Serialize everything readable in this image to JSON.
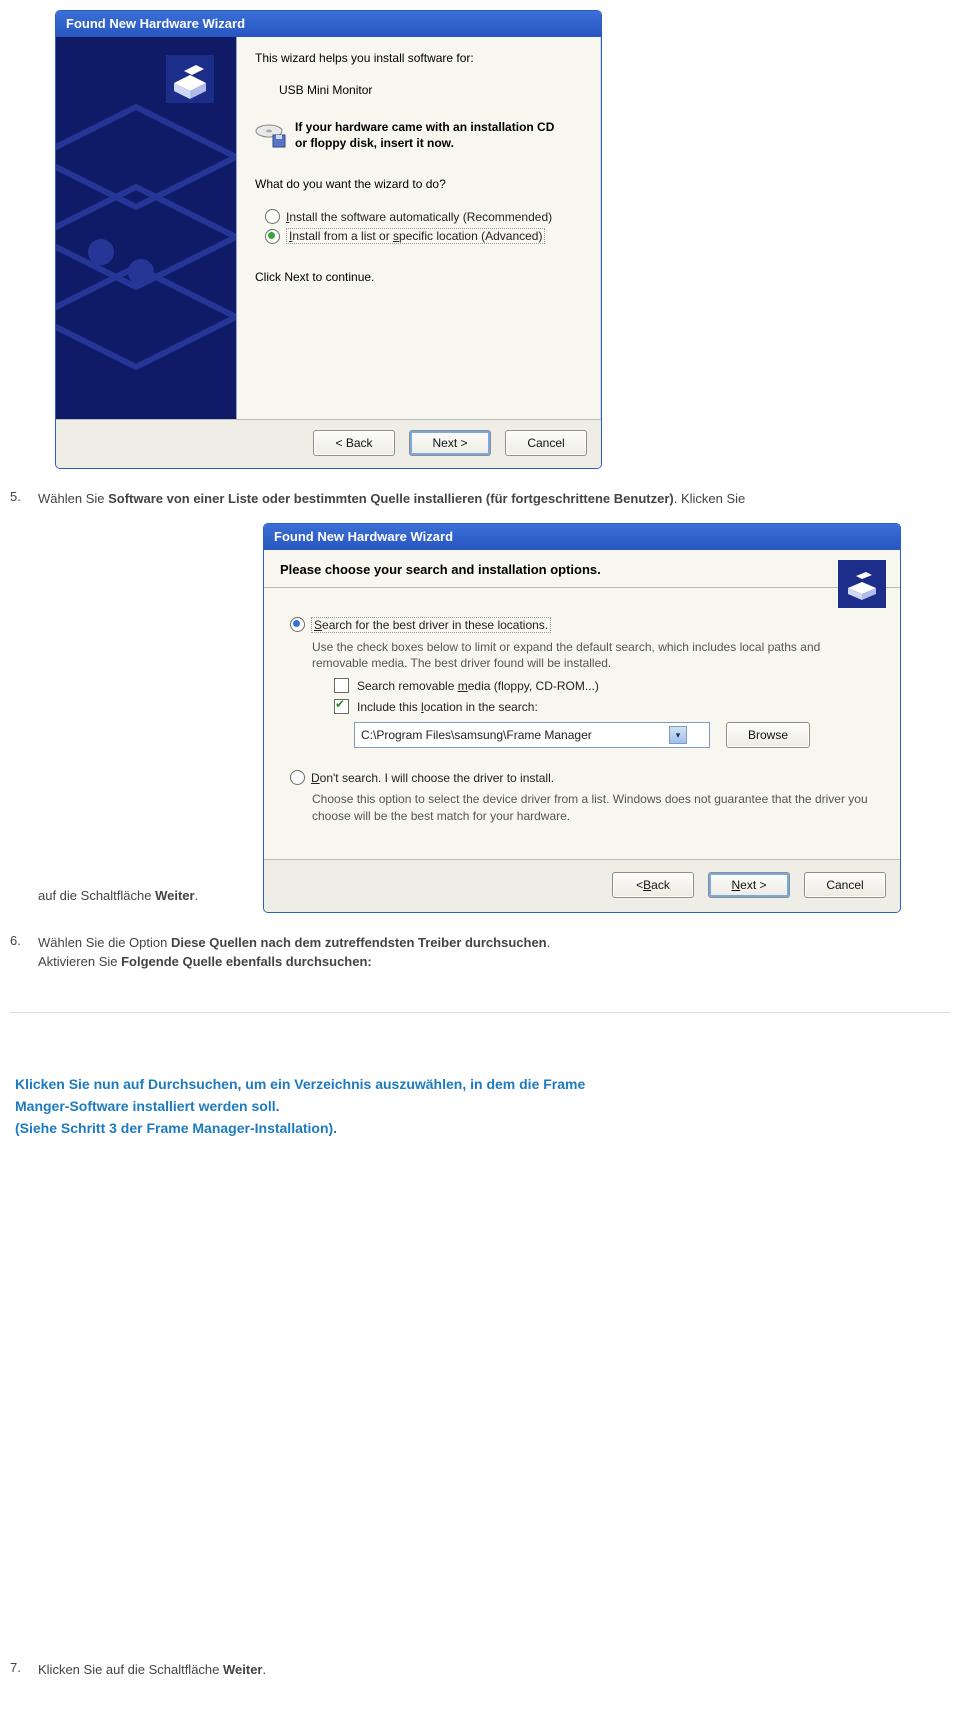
{
  "dialog1": {
    "title": "Found New Hardware Wizard",
    "intro": "This wizard helps you install software for:",
    "device": "USB Mini Monitor",
    "cd_line1": "If your hardware came with an installation CD",
    "cd_line2": "or floppy disk, insert it now.",
    "question": "What do you want the wizard to do?",
    "radio1_pre": "I",
    "radio1": "nstall the software automatically (Recommended)",
    "radio2_pre": "I",
    "radio2_mid": "nstall from a list or ",
    "radio2_u": "s",
    "radio2_post": "pecific location (Advanced)",
    "click_next": "Click Next to continue.",
    "back": "< Back",
    "next": "Next >",
    "cancel": "Cancel"
  },
  "dialog2": {
    "title": "Found New Hardware Wizard",
    "heading": "Please choose your search and installation options.",
    "opt1_pre": "S",
    "opt1": "earch for the best driver in these locations.",
    "opt1_desc": "Use the check boxes below to limit or expand the default search, which includes local paths and removable media. The best driver found will be installed.",
    "chk1_pre": "Search removable ",
    "chk1_u": "m",
    "chk1_post": "edia (floppy, CD-ROM...)",
    "chk2_pre": "Include this ",
    "chk2_u": "l",
    "chk2_post": "ocation in the search:",
    "path": "C:\\Program Files\\samsung\\Frame Manager",
    "browse": "Browse",
    "opt2_pre": "D",
    "opt2": "on't search. I will choose the driver to install.",
    "opt2_desc": "Choose this option to select the device driver from a list. Windows does not guarantee that the driver you choose will be the best match for your hardware.",
    "back_pre": "< ",
    "back_u": "B",
    "back_post": "ack",
    "next_pre": "",
    "next_u": "N",
    "next_post": "ext >",
    "cancel": "Cancel"
  },
  "text": {
    "step5_num": "5.",
    "step5_a": "Wählen Sie ",
    "step5_b": "Software von einer Liste oder bestimmten Quelle installieren (für fortgeschrittene Benutzer)",
    "step5_c": ". Klicken Sie",
    "step5_after_a": "auf die Schaltfläche ",
    "step5_after_b": "Weiter",
    "step5_after_c": ".",
    "step6_num": "6.",
    "step6_a": "Wählen Sie die Option ",
    "step6_b": "Diese Quellen nach dem zutreffendsten Treiber durchsuchen",
    "step6_c": ".",
    "step6_d": "Aktivieren Sie ",
    "step6_e": "Folgende Quelle ebenfalls durchsuchen:",
    "note1": "Klicken Sie nun auf Durchsuchen, um ein Verzeichnis auszuwählen, in dem die Frame",
    "note2": "Manger-Software installiert werden soll.",
    "note3": "(Siehe Schritt 3 der Frame Manager-Installation).",
    "step7_num": "7.",
    "step7_a": "Klicken Sie auf die Schaltfläche ",
    "step7_b": "Weiter",
    "step7_c": "."
  }
}
